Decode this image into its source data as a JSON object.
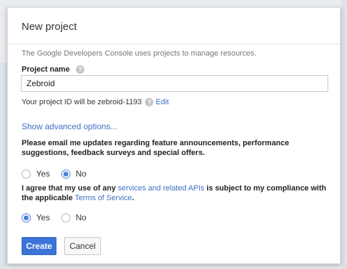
{
  "dialog": {
    "title": "New project",
    "intro": "The Google Developers Console uses projects to manage resources.",
    "project_name_label": "Project name",
    "project_name_value": "Zebroid",
    "project_id_text": "Your project ID will be zebroid-1193",
    "edit_link": "Edit",
    "advanced_link": "Show advanced options...",
    "email_question": "Please email me updates regarding feature announcements, performance suggestions, feedback surveys and special offers.",
    "email_options": [
      {
        "label": "Yes",
        "checked": false
      },
      {
        "label": "No",
        "checked": true
      }
    ],
    "agree_prefix": "I agree that my use of any ",
    "agree_link1": "services and related APIs",
    "agree_middle": " is subject to my compliance with the applicable ",
    "agree_link2": "Terms of Service",
    "agree_suffix": ".",
    "agree_options": [
      {
        "label": "Yes",
        "checked": true
      },
      {
        "label": "No",
        "checked": false
      }
    ],
    "create_button": "Create",
    "cancel_button": "Cancel"
  },
  "colors": {
    "accent": "#3b74d6",
    "link": "#3b6fc4",
    "radio_checked": "#4a7fd8"
  },
  "icons": {
    "help": "help-icon"
  }
}
